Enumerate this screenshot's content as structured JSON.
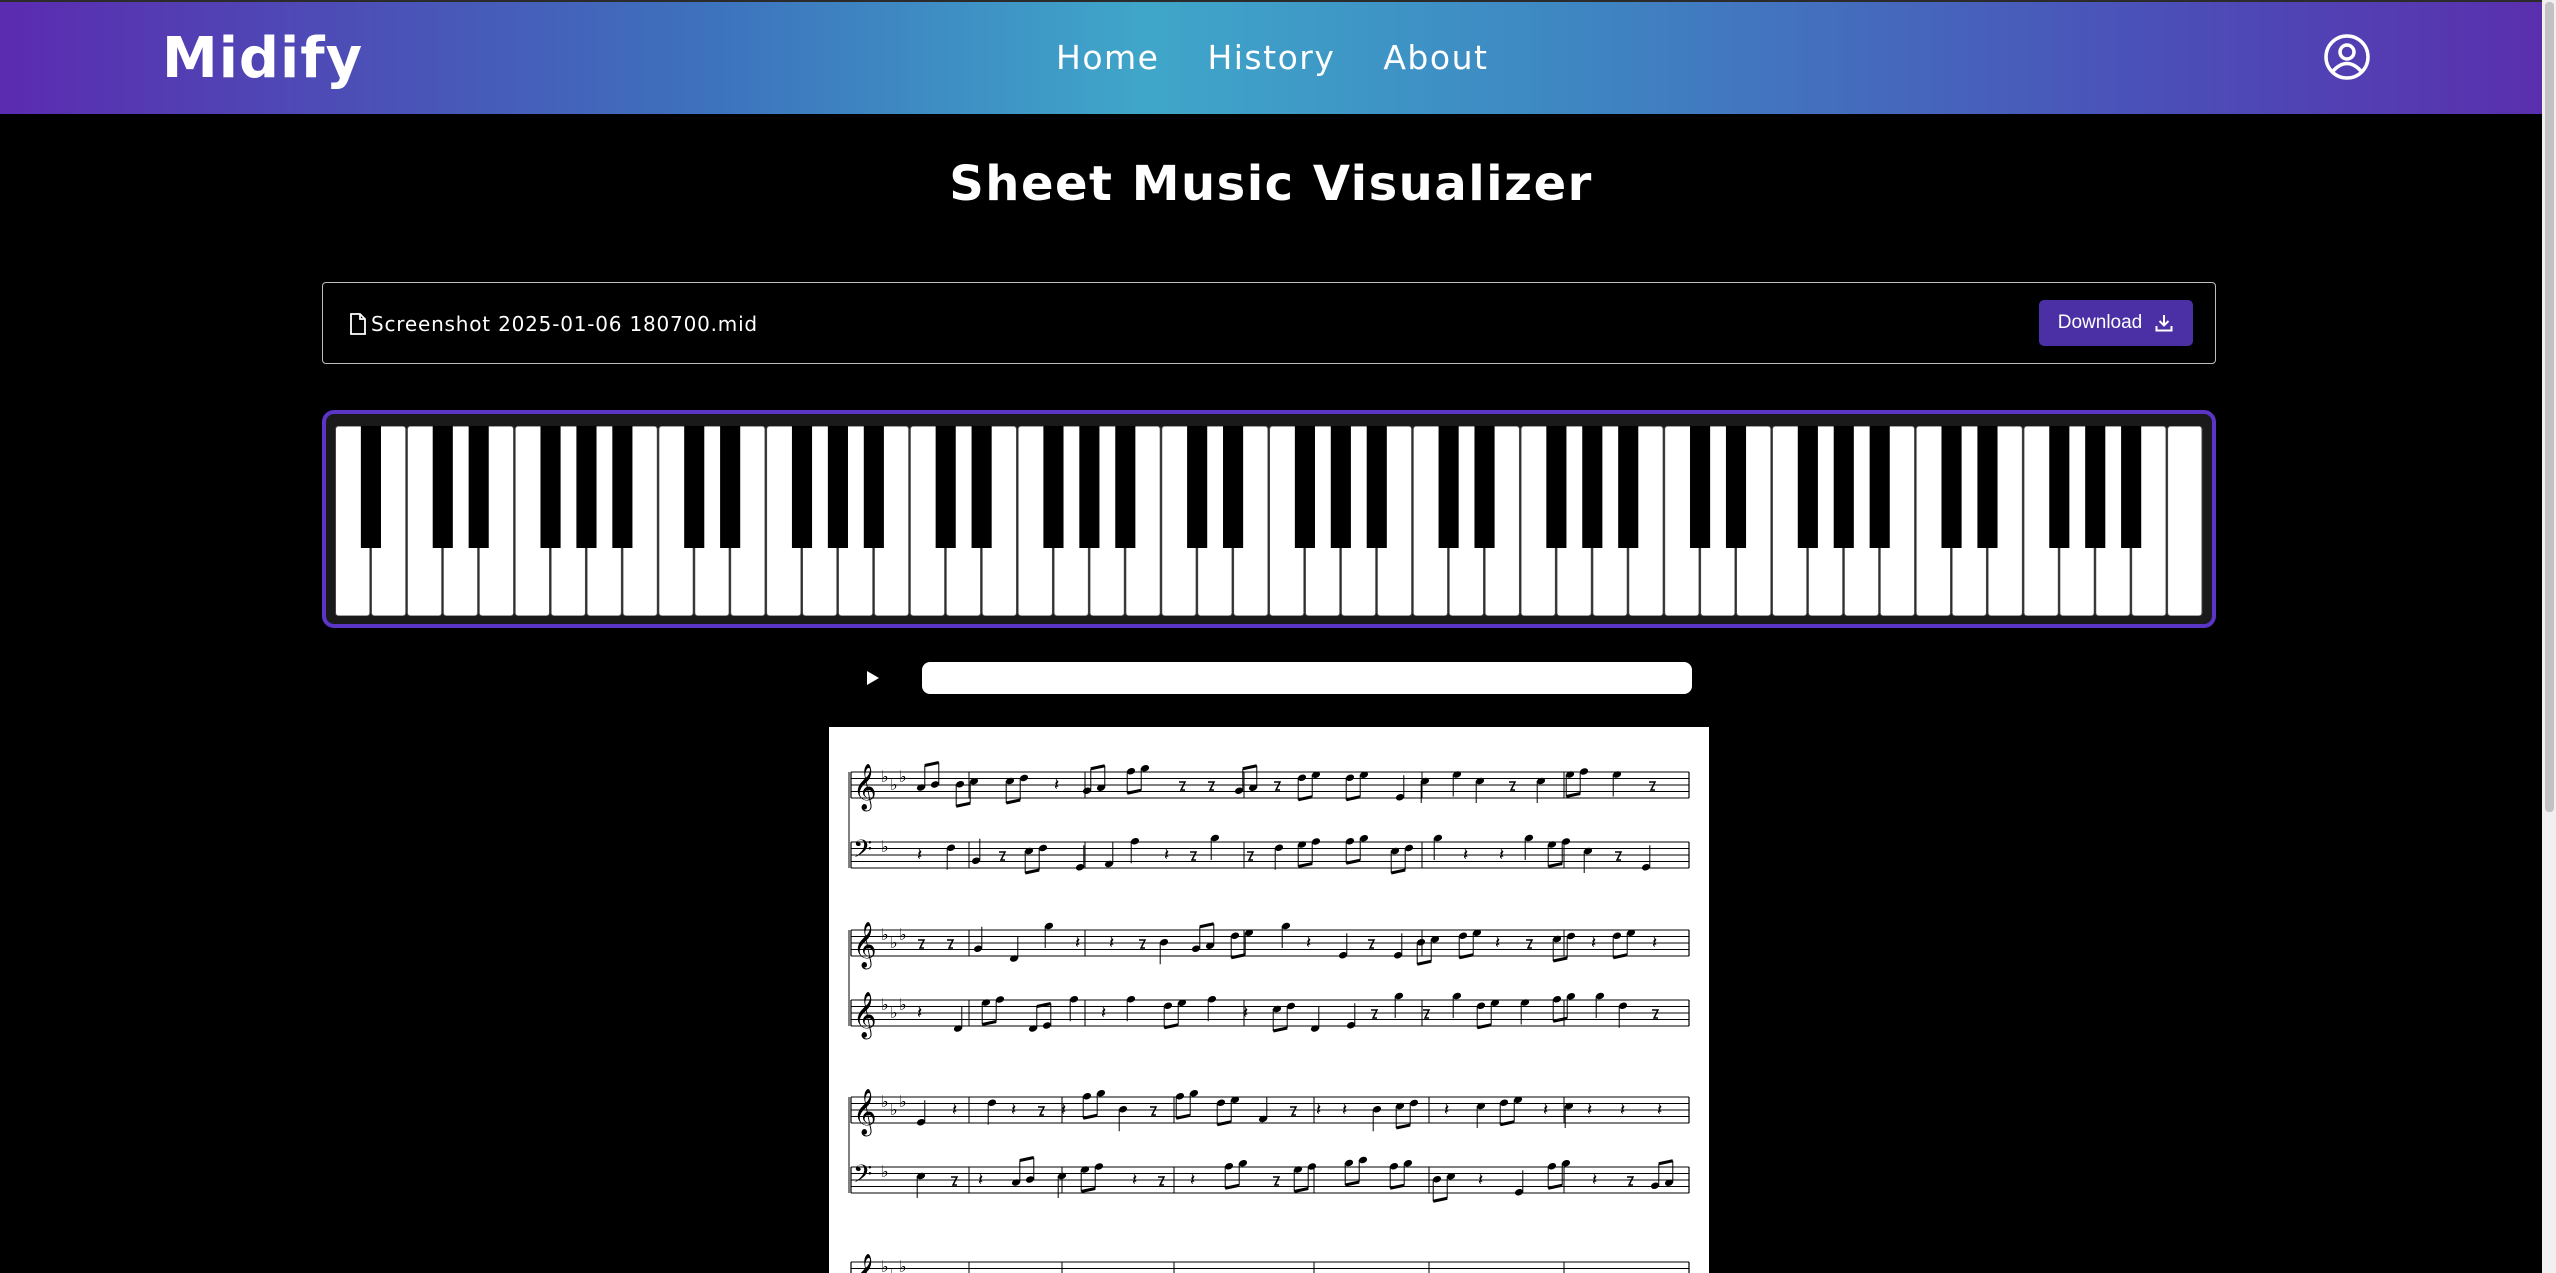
{
  "nav": {
    "brand": "Midify",
    "links": [
      "Home",
      "History",
      "About"
    ]
  },
  "page": {
    "title": "Sheet Music Visualizer"
  },
  "file": {
    "name": "Screenshot 2025-01-06 180700.mid",
    "download_label": "Download"
  },
  "icons": {
    "user": "user-circle-icon",
    "file": "file-icon",
    "download": "download-icon",
    "play": "play-icon"
  },
  "colors": {
    "accent": "#4a2fa5",
    "piano_border": "#5a35c6",
    "nav_gradient_start": "#5b2bb0",
    "nav_gradient_mid": "#3fa6c9"
  },
  "player": {
    "progress": 0
  }
}
